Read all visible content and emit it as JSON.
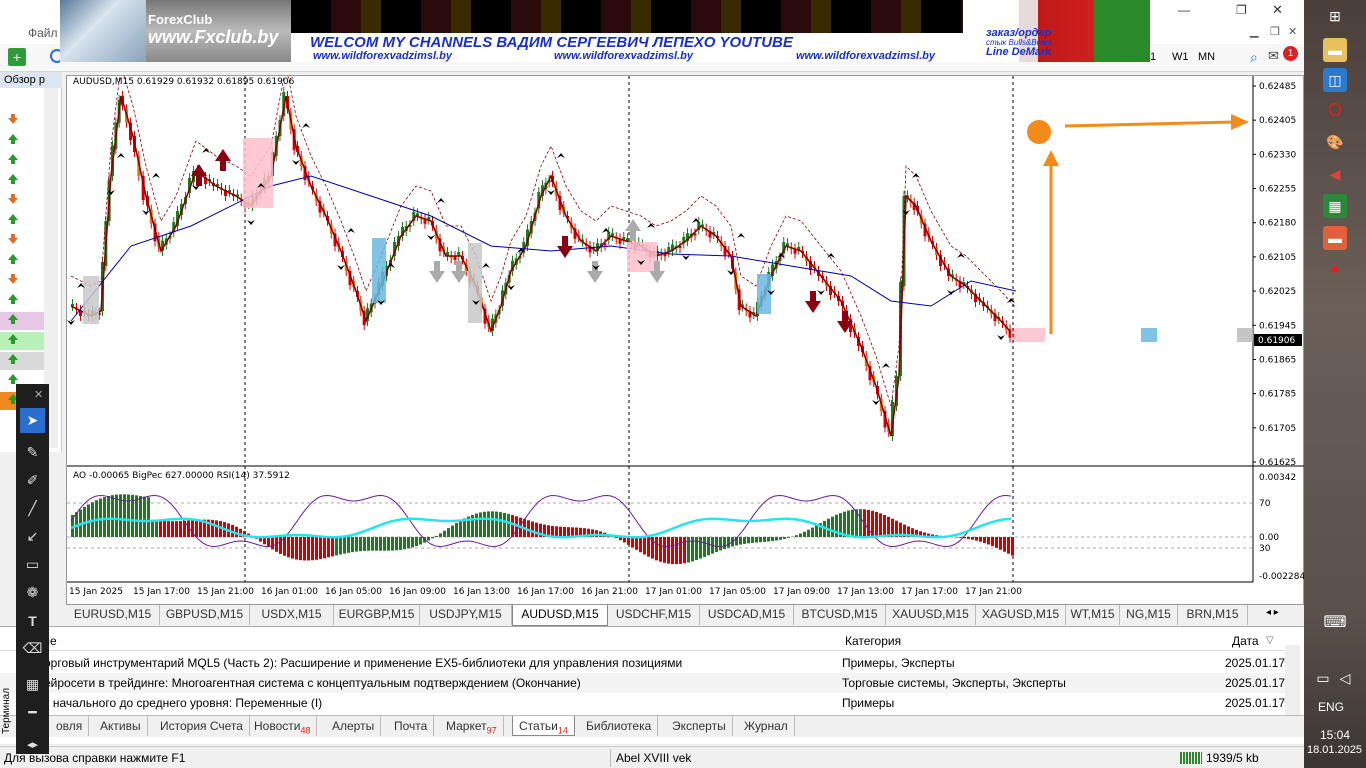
{
  "window": {
    "menu_file": "Файл",
    "market_watch_title": "Обзор р",
    "min_btn": "—",
    "max_btn": "❐",
    "close_btn": "✕"
  },
  "banner": {
    "logo": "ForexClub",
    "site": "www.Fxclub.by",
    "headline": "WELCOM MY CHANNELS ВАДИМ СЕРГЕЕВИЧ ЛЕПЕХО YOUTUBE",
    "link1": "www.wildforexvadzimsl.by",
    "link2": "www.wildforexvadzimsl.by",
    "link3": "www.wildforexvadzimsl.by",
    "order1": "заказ/ордер",
    "order2": "стык Bulls&Bears",
    "order3": "Line DeMark"
  },
  "toolbar": {
    "tf_w1": "W1",
    "tf_mn": "MN",
    "tf_partial": "1",
    "notif_count": "1"
  },
  "chart": {
    "header": "AUDUSD,M15  0.61929 0.61932 0.61895 0.61906",
    "indicator_header": "AO -0.00065  BigPec 627.00000  RSI(14) 37.5912",
    "current_price": "0.61906",
    "price_labels": [
      "0.62485",
      "0.62405",
      "0.62330",
      "0.62255",
      "0.62180",
      "0.62105",
      "0.62025",
      "0.61945",
      "0.61865",
      "0.61785",
      "0.61705",
      "0.61625"
    ],
    "indicator_labels": [
      "0.00342",
      "70",
      "0.00",
      "30",
      "-0.002284"
    ],
    "time_labels": [
      "15 Jan 2025",
      "15 Jan 17:00",
      "15 Jan 21:00",
      "16 Jan 01:00",
      "16 Jan 05:00",
      "16 Jan 09:00",
      "16 Jan 13:00",
      "16 Jan 17:00",
      "16 Jan 21:00",
      "17 Jan 01:00",
      "17 Jan 05:00",
      "17 Jan 09:00",
      "17 Jan 13:00",
      "17 Jan 17:00",
      "17 Jan 21:00"
    ],
    "colors": {
      "bull": "#1e7a1e",
      "bear": "#d40000",
      "ma": "#0000aa",
      "rsi": "#6a1a9a",
      "cyan": "#22e5ef",
      "arrow": "#f28a1c"
    }
  },
  "chart_tabs": [
    "EURUSD,M15",
    "GBPUSD,M15",
    "USDX,M15",
    "EURGBP,M15",
    "USDJPY,M15",
    "AUDUSD,M15",
    "USDCHF,M15",
    "USDCAD,M15",
    "BTCUSD,M15",
    "XAUUSD,M15",
    "XAGUSD,M15",
    "WT,M15",
    "NG,M15",
    "BRN,M15"
  ],
  "active_chart_tab": "AUDUSD,M15",
  "terminal": {
    "col_name": "ание",
    "col_category": "Категория",
    "col_date": "Дата",
    "rows": [
      {
        "name": "орговый инструментарий MQL5 (Часть 2): Расширение и применение EX5-библиотеки для управления позициями",
        "category": "Примеры, Эксперты",
        "date": "2025.01.17"
      },
      {
        "name": "ейросети в трейдинге: Многоагентная система с концептуальным подтверждением (Окончание)",
        "category": "Торговые системы, Эксперты, Эксперты",
        "date": "2025.01.17"
      },
      {
        "name": "т начального до среднего уровня: Переменные (I)",
        "category": "Примеры",
        "date": "2025.01.17"
      }
    ],
    "side_label": "Терминал",
    "tabs": [
      {
        "label": "овля",
        "badge": ""
      },
      {
        "label": "Активы",
        "badge": ""
      },
      {
        "label": "История Счета",
        "badge": ""
      },
      {
        "label": "Новости",
        "badge": "48"
      },
      {
        "label": "Алерты",
        "badge": ""
      },
      {
        "label": "Почта",
        "badge": ""
      },
      {
        "label": "Маркет",
        "badge": "97"
      },
      {
        "label": "Статьи",
        "badge": "14"
      },
      {
        "label": "Библиотека",
        "badge": ""
      },
      {
        "label": "Эксперты",
        "badge": ""
      },
      {
        "label": "Журнал",
        "badge": ""
      }
    ]
  },
  "status": {
    "help": "Для вызова справки нажмите F1",
    "profile": "Abel XVIII vek",
    "traffic": "1939/5 kb"
  },
  "taskbar": {
    "lang": "ENG",
    "time": "15:04",
    "date": "18.01.2025"
  }
}
